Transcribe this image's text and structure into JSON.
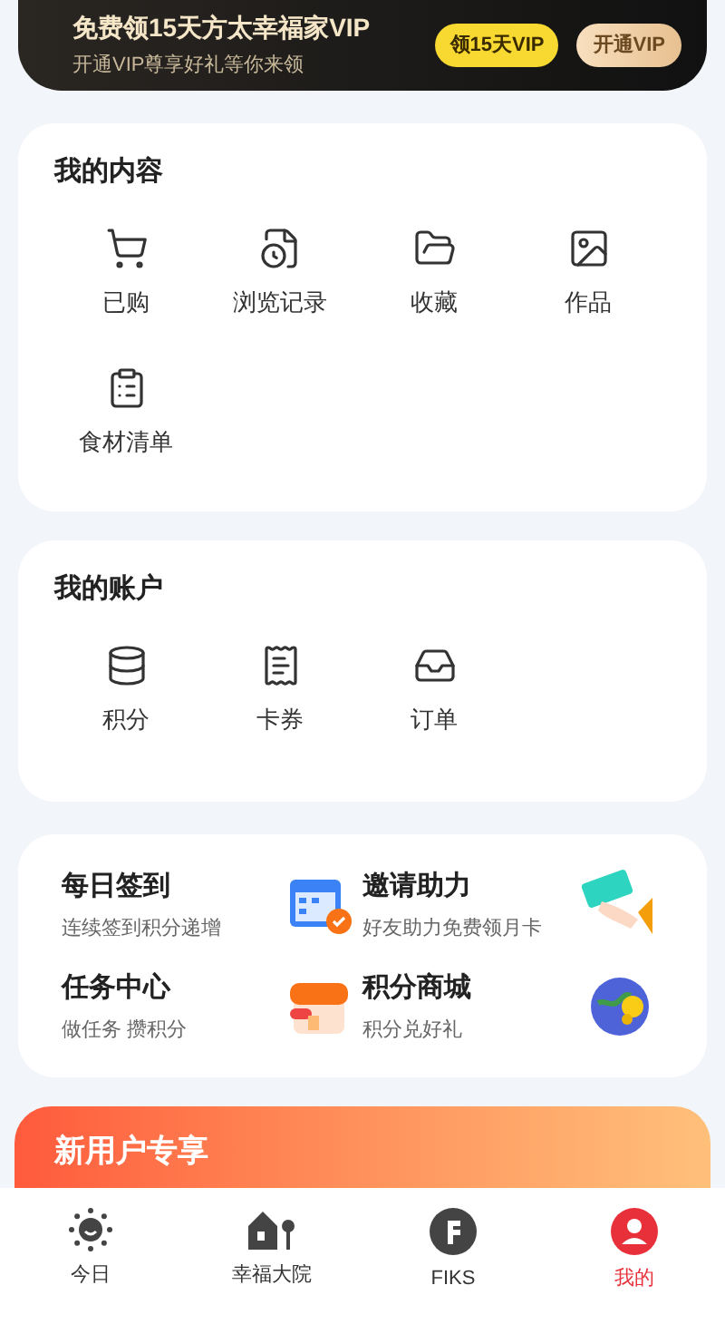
{
  "vip_banner": {
    "title": "免费领15天方太幸福家VIP",
    "subtitle": "开通VIP尊享好礼等你来领",
    "buttons": [
      "领15天VIP",
      "开通VIP"
    ]
  },
  "my_content": {
    "title": "我的内容",
    "items": [
      "已购",
      "浏览记录",
      "收藏",
      "作品",
      "食材清单"
    ]
  },
  "my_account": {
    "title": "我的账户",
    "items": [
      "积分",
      "卡券",
      "订单"
    ]
  },
  "features": [
    {
      "title": "每日签到",
      "subtitle": "连续签到积分递增"
    },
    {
      "title": "邀请助力",
      "subtitle": "好友助力免费领月卡"
    },
    {
      "title": "任务中心",
      "subtitle": "做任务 攒积分"
    },
    {
      "title": "积分商城",
      "subtitle": "积分兑好礼"
    }
  ],
  "promo_banner": {
    "title": "新用户专享"
  },
  "tab_bar": [
    {
      "label": "今日",
      "selected": false
    },
    {
      "label": "幸福大院",
      "selected": false
    },
    {
      "label": "FIKS",
      "selected": false
    },
    {
      "label": "我的",
      "selected": true
    }
  ]
}
